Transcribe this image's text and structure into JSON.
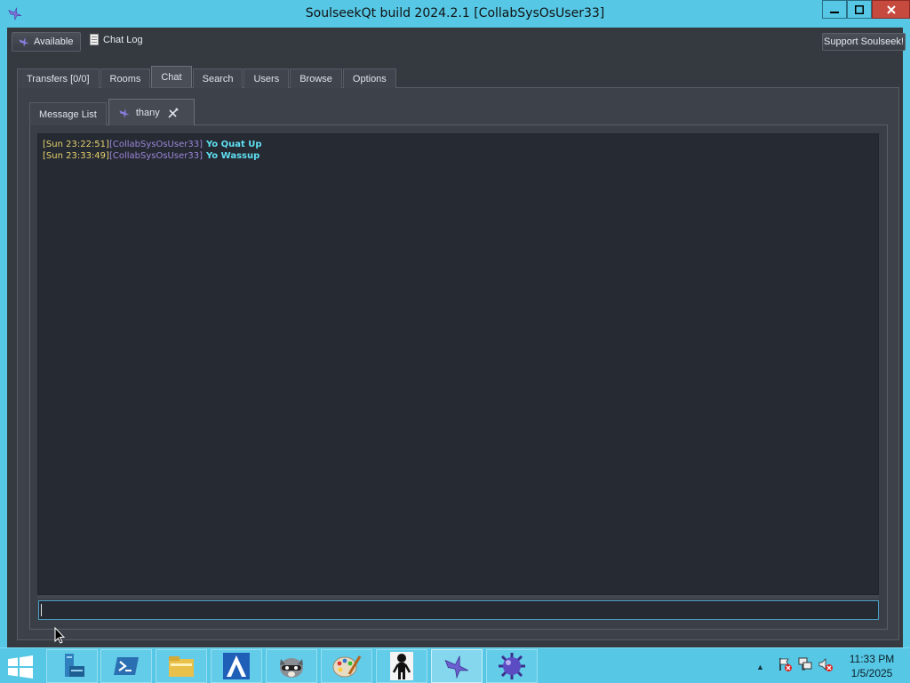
{
  "window": {
    "title": "SoulseekQt build 2024.2.1 [CollabSysOsUser33]",
    "controls": {
      "minimize": "▁",
      "maximize": "□",
      "close": "✕"
    }
  },
  "toolbar": {
    "status_label": "Available",
    "chat_log_label": "Chat Log",
    "support_label": "Support Soulseek!"
  },
  "main_tabs": [
    {
      "label": "Transfers [0/0]",
      "active": false
    },
    {
      "label": "Rooms",
      "active": false
    },
    {
      "label": "Chat",
      "active": true
    },
    {
      "label": "Search",
      "active": false
    },
    {
      "label": "Users",
      "active": false
    },
    {
      "label": "Browse",
      "active": false
    },
    {
      "label": "Options",
      "active": false
    }
  ],
  "chat_tabs": [
    {
      "label": "Message List",
      "active": false
    },
    {
      "label": "thany",
      "active": true
    }
  ],
  "messages": [
    {
      "timestamp": "Sun 23:22:51",
      "user": "CollabSysOsUser33",
      "text": "Yo Quat Up"
    },
    {
      "timestamp": "Sun 23:33:49",
      "user": "CollabSysOsUser33",
      "text": "Yo Wassup"
    }
  ],
  "chat_input": {
    "value": ""
  },
  "taskbar": {
    "apps": [
      "server-manager",
      "powershell",
      "file-explorer",
      "app-a",
      "raccoon-app",
      "paint",
      "figure-app",
      "soulseek",
      "mine-app"
    ],
    "clock_time": "11:33 PM",
    "clock_date": "1/5/2025"
  },
  "colors": {
    "titlebar": "#56c8e6",
    "chat_bg": "#262a33",
    "timestamp": "#e6d36b",
    "username": "#9b86d8",
    "message": "#5ee0f2"
  }
}
